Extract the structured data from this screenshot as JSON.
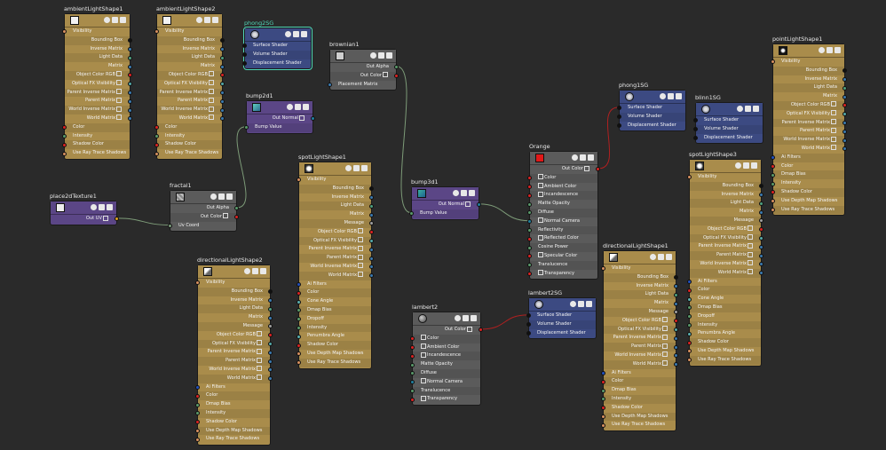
{
  "colors": {
    "background": "#2a2a2a",
    "light_node": "#a98c4b",
    "shading_group": "#3c4a82",
    "bump": "#5b4686",
    "material": "#5b5b5b",
    "wire_red": "#b02020",
    "wire_green": "#7d9b78",
    "selection": "#4fd6b8"
  },
  "nodes": [
    {
      "id": "ambientLightShape1",
      "title": "ambientLightShape1",
      "kind": "gold",
      "thumb": "white",
      "rows": [
        {
          "l": "Visibility",
          "a": "left"
        },
        {
          "l": "Bounding Box",
          "a": "right"
        },
        {
          "l": "Inverse Matrix",
          "a": "right"
        },
        {
          "l": "Light Data",
          "a": "right"
        },
        {
          "l": "Matrix",
          "a": "right"
        },
        {
          "l": "Object Color RGB",
          "a": "right",
          "e": 1
        },
        {
          "l": "Optical FX Visibility",
          "a": "right",
          "e": 1
        },
        {
          "l": "Parent Inverse Matrix",
          "a": "right",
          "e": 1
        },
        {
          "l": "Parent Matrix",
          "a": "right",
          "e": 1
        },
        {
          "l": "World Inverse Matrix",
          "a": "right",
          "e": 1
        },
        {
          "l": "World Matrix",
          "a": "right",
          "e": 1
        },
        {
          "l": "Color",
          "a": "left"
        },
        {
          "l": "Intensity",
          "a": "left"
        },
        {
          "l": "Shadow Color",
          "a": "left"
        },
        {
          "l": "Use Ray Trace Shadows",
          "a": "left"
        }
      ]
    },
    {
      "id": "ambientLightShape2",
      "title": "ambientLightShape2",
      "kind": "gold",
      "thumb": "white",
      "rows": [
        {
          "l": "Visibility",
          "a": "left"
        },
        {
          "l": "Bounding Box",
          "a": "right"
        },
        {
          "l": "Inverse Matrix",
          "a": "right"
        },
        {
          "l": "Light Data",
          "a": "right"
        },
        {
          "l": "Matrix",
          "a": "right"
        },
        {
          "l": "Object Color RGB",
          "a": "right",
          "e": 1
        },
        {
          "l": "Optical FX Visibility",
          "a": "right",
          "e": 1
        },
        {
          "l": "Parent Inverse Matrix",
          "a": "right",
          "e": 1
        },
        {
          "l": "Parent Matrix",
          "a": "right",
          "e": 1
        },
        {
          "l": "World Inverse Matrix",
          "a": "right",
          "e": 1
        },
        {
          "l": "World Matrix",
          "a": "right",
          "e": 1
        },
        {
          "l": "Color",
          "a": "left"
        },
        {
          "l": "Intensity",
          "a": "left"
        },
        {
          "l": "Shadow Color",
          "a": "left"
        },
        {
          "l": "Use Ray Trace Shadows",
          "a": "left"
        }
      ]
    },
    {
      "id": "phong2SG",
      "title": "phong2SG",
      "kind": "blue",
      "thumb": "sg",
      "selected": true,
      "rows": [
        {
          "l": "Surface Shader",
          "a": "left"
        },
        {
          "l": "Volume Shader",
          "a": "left"
        },
        {
          "l": "Displacement Shader",
          "a": "left"
        }
      ]
    },
    {
      "id": "brownian1",
      "title": "brownian1",
      "kind": "grey",
      "thumb": "grey",
      "rows": [
        {
          "l": "Out Alpha",
          "a": "right"
        },
        {
          "l": "Out Color",
          "a": "right",
          "e": 1
        },
        {
          "l": "Placement Matrix",
          "a": "left"
        }
      ]
    },
    {
      "id": "bump2d1",
      "title": "bump2d1",
      "kind": "purple",
      "thumb": "bump",
      "rows": [
        {
          "l": "Out Normal",
          "a": "right",
          "e": 1
        },
        {
          "l": "Bump Value",
          "a": "left"
        }
      ]
    },
    {
      "id": "place2dTexture1",
      "title": "place2dTexture1",
      "kind": "purple",
      "thumb": "place",
      "rows": [
        {
          "l": "Out UV",
          "a": "right",
          "e": 1
        }
      ]
    },
    {
      "id": "fractal1",
      "title": "fractal1",
      "kind": "grey",
      "thumb": "fractal",
      "rows": [
        {
          "l": "Out Alpha",
          "a": "right"
        },
        {
          "l": "Out Color",
          "a": "right",
          "e": 1
        },
        {
          "l": "Uv Coord",
          "a": "left"
        }
      ]
    },
    {
      "id": "spotLightShape1",
      "title": "spotLightShape1",
      "kind": "gold",
      "thumb": "spot",
      "rows": [
        {
          "l": "Visibility",
          "a": "left"
        },
        {
          "l": "Bounding Box",
          "a": "right"
        },
        {
          "l": "Inverse Matrix",
          "a": "right"
        },
        {
          "l": "Light Data",
          "a": "right"
        },
        {
          "l": "Matrix",
          "a": "right"
        },
        {
          "l": "Message",
          "a": "right"
        },
        {
          "l": "Object Color RGB",
          "a": "right",
          "e": 1
        },
        {
          "l": "Optical FX Visibility",
          "a": "right",
          "e": 1
        },
        {
          "l": "Parent Inverse Matrix",
          "a": "right",
          "e": 1
        },
        {
          "l": "Parent Matrix",
          "a": "right",
          "e": 1
        },
        {
          "l": "World Inverse Matrix",
          "a": "right",
          "e": 1
        },
        {
          "l": "World Matrix",
          "a": "right",
          "e": 1
        },
        {
          "l": "Ai Filters",
          "a": "left"
        },
        {
          "l": "Color",
          "a": "left"
        },
        {
          "l": "Cone Angle",
          "a": "left"
        },
        {
          "l": "Dmap Bias",
          "a": "left"
        },
        {
          "l": "Dropoff",
          "a": "left"
        },
        {
          "l": "Intensity",
          "a": "left"
        },
        {
          "l": "Penumbra Angle",
          "a": "left"
        },
        {
          "l": "Shadow Color",
          "a": "left"
        },
        {
          "l": "Use Depth Map Shadows",
          "a": "left"
        },
        {
          "l": "Use Ray Trace Shadows",
          "a": "left"
        }
      ]
    },
    {
      "id": "directionalLightShape2",
      "title": "directionalLightShape2",
      "kind": "gold",
      "thumb": "dir",
      "rows": [
        {
          "l": "Visibility",
          "a": "left"
        },
        {
          "l": "Bounding Box",
          "a": "right"
        },
        {
          "l": "Inverse Matrix",
          "a": "right"
        },
        {
          "l": "Light Data",
          "a": "right"
        },
        {
          "l": "Matrix",
          "a": "right"
        },
        {
          "l": "Message",
          "a": "right"
        },
        {
          "l": "Object Color RGB",
          "a": "right",
          "e": 1
        },
        {
          "l": "Optical FX Visibility",
          "a": "right",
          "e": 1
        },
        {
          "l": "Parent Inverse Matrix",
          "a": "right",
          "e": 1
        },
        {
          "l": "Parent Matrix",
          "a": "right",
          "e": 1
        },
        {
          "l": "World Inverse Matrix",
          "a": "right",
          "e": 1
        },
        {
          "l": "World Matrix",
          "a": "right",
          "e": 1
        },
        {
          "l": "Ai Filters",
          "a": "left"
        },
        {
          "l": "Color",
          "a": "left"
        },
        {
          "l": "Dmap Bias",
          "a": "left"
        },
        {
          "l": "Intensity",
          "a": "left"
        },
        {
          "l": "Shadow Color",
          "a": "left"
        },
        {
          "l": "Use Depth Map Shadows",
          "a": "left"
        },
        {
          "l": "Use Ray Trace Shadows",
          "a": "left"
        }
      ]
    },
    {
      "id": "bump3d1",
      "title": "bump3d1",
      "kind": "purple",
      "thumb": "bump3",
      "rows": [
        {
          "l": "Out Normal",
          "a": "right",
          "e": 1
        },
        {
          "l": "Bump Value",
          "a": "left"
        }
      ]
    },
    {
      "id": "Orange",
      "title": "Orange",
      "kind": "grey",
      "thumb": "red",
      "rows": [
        {
          "l": "Out Color",
          "a": "right",
          "e": 1
        },
        {
          "l": "Color",
          "a": "left",
          "e": 1
        },
        {
          "l": "Ambient Color",
          "a": "left",
          "e": 1
        },
        {
          "l": "Incandescence",
          "a": "left",
          "e": 1
        },
        {
          "l": "Matte Opacity",
          "a": "left"
        },
        {
          "l": "Diffuse",
          "a": "left"
        },
        {
          "l": "Normal Camera",
          "a": "left",
          "e": 1
        },
        {
          "l": "Reflectivity",
          "a": "left"
        },
        {
          "l": "Reflected Color",
          "a": "left",
          "e": 1
        },
        {
          "l": "Cosine Power",
          "a": "left"
        },
        {
          "l": "Specular Color",
          "a": "left",
          "e": 1
        },
        {
          "l": "Translucence",
          "a": "left"
        },
        {
          "l": "Transparency",
          "a": "left",
          "e": 1
        }
      ]
    },
    {
      "id": "lambert2",
      "title": "lambert2",
      "kind": "grey",
      "thumb": "ball",
      "rows": [
        {
          "l": "Out Color",
          "a": "right",
          "e": 1
        },
        {
          "l": "Color",
          "a": "left",
          "e": 1
        },
        {
          "l": "Ambient Color",
          "a": "left",
          "e": 1
        },
        {
          "l": "Incandescence",
          "a": "left",
          "e": 1
        },
        {
          "l": "Matte Opacity",
          "a": "left"
        },
        {
          "l": "Diffuse",
          "a": "left"
        },
        {
          "l": "Normal Camera",
          "a": "left",
          "e": 1
        },
        {
          "l": "Translucence",
          "a": "left"
        },
        {
          "l": "Transparency",
          "a": "left",
          "e": 1
        }
      ]
    },
    {
      "id": "lambert2SG",
      "title": "lambert2SG",
      "kind": "blue",
      "thumb": "sg",
      "rows": [
        {
          "l": "Surface Shader",
          "a": "left"
        },
        {
          "l": "Volume Shader",
          "a": "left"
        },
        {
          "l": "Displacement Shader",
          "a": "left"
        }
      ]
    },
    {
      "id": "phong1SG",
      "title": "phong1SG",
      "kind": "blue",
      "thumb": "sg",
      "rows": [
        {
          "l": "Surface Shader",
          "a": "left"
        },
        {
          "l": "Volume Shader",
          "a": "left"
        },
        {
          "l": "Displacement Shader",
          "a": "left"
        }
      ]
    },
    {
      "id": "blinn1SG",
      "title": "blinn1SG",
      "kind": "blue",
      "thumb": "sg",
      "rows": [
        {
          "l": "Surface Shader",
          "a": "left"
        },
        {
          "l": "Volume Shader",
          "a": "left"
        },
        {
          "l": "Displacement Shader",
          "a": "left"
        }
      ]
    },
    {
      "id": "directionalLightShape1",
      "title": "directionalLightShape1",
      "kind": "gold",
      "thumb": "dir",
      "rows": [
        {
          "l": "Visibility",
          "a": "left"
        },
        {
          "l": "Bounding Box",
          "a": "right"
        },
        {
          "l": "Inverse Matrix",
          "a": "right"
        },
        {
          "l": "Light Data",
          "a": "right"
        },
        {
          "l": "Matrix",
          "a": "right"
        },
        {
          "l": "Message",
          "a": "right"
        },
        {
          "l": "Object Color RGB",
          "a": "right",
          "e": 1
        },
        {
          "l": "Optical FX Visibility",
          "a": "right",
          "e": 1
        },
        {
          "l": "Parent Inverse Matrix",
          "a": "right",
          "e": 1
        },
        {
          "l": "Parent Matrix",
          "a": "right",
          "e": 1
        },
        {
          "l": "World Inverse Matrix",
          "a": "right",
          "e": 1
        },
        {
          "l": "World Matrix",
          "a": "right",
          "e": 1
        },
        {
          "l": "Ai Filters",
          "a": "left"
        },
        {
          "l": "Color",
          "a": "left"
        },
        {
          "l": "Dmap Bias",
          "a": "left"
        },
        {
          "l": "Intensity",
          "a": "left"
        },
        {
          "l": "Shadow Color",
          "a": "left"
        },
        {
          "l": "Use Depth Map Shadows",
          "a": "left"
        },
        {
          "l": "Use Ray Trace Shadows",
          "a": "left"
        }
      ]
    },
    {
      "id": "spotLightShape3",
      "title": "spotLightShape3",
      "kind": "gold",
      "thumb": "spot",
      "rows": [
        {
          "l": "Visibility",
          "a": "left"
        },
        {
          "l": "Bounding Box",
          "a": "right"
        },
        {
          "l": "Inverse Matrix",
          "a": "right"
        },
        {
          "l": "Light Data",
          "a": "right"
        },
        {
          "l": "Matrix",
          "a": "right"
        },
        {
          "l": "Message",
          "a": "right"
        },
        {
          "l": "Object Color RGB",
          "a": "right",
          "e": 1
        },
        {
          "l": "Optical FX Visibility",
          "a": "right",
          "e": 1
        },
        {
          "l": "Parent Inverse Matrix",
          "a": "right",
          "e": 1
        },
        {
          "l": "Parent Matrix",
          "a": "right",
          "e": 1
        },
        {
          "l": "World Inverse Matrix",
          "a": "right",
          "e": 1
        },
        {
          "l": "World Matrix",
          "a": "right",
          "e": 1
        },
        {
          "l": "Ai Filters",
          "a": "left"
        },
        {
          "l": "Color",
          "a": "left"
        },
        {
          "l": "Cone Angle",
          "a": "left"
        },
        {
          "l": "Dmap Bias",
          "a": "left"
        },
        {
          "l": "Dropoff",
          "a": "left"
        },
        {
          "l": "Intensity",
          "a": "left"
        },
        {
          "l": "Penumbra Angle",
          "a": "left"
        },
        {
          "l": "Shadow Color",
          "a": "left"
        },
        {
          "l": "Use Depth Map Shadows",
          "a": "left"
        },
        {
          "l": "Use Ray Trace Shadows",
          "a": "left"
        }
      ]
    },
    {
      "id": "pointLightShape1",
      "title": "pointLightShape1",
      "kind": "gold",
      "thumb": "point",
      "rows": [
        {
          "l": "Visibility",
          "a": "left"
        },
        {
          "l": "Bounding Box",
          "a": "right"
        },
        {
          "l": "Inverse Matrix",
          "a": "right"
        },
        {
          "l": "Light Data",
          "a": "right"
        },
        {
          "l": "Matrix",
          "a": "right"
        },
        {
          "l": "Object Color RGB",
          "a": "right",
          "e": 1
        },
        {
          "l": "Optical FX Visibility",
          "a": "right",
          "e": 1
        },
        {
          "l": "Parent Inverse Matrix",
          "a": "right",
          "e": 1
        },
        {
          "l": "Parent Matrix",
          "a": "right",
          "e": 1
        },
        {
          "l": "World Inverse Matrix",
          "a": "right",
          "e": 1
        },
        {
          "l": "World Matrix",
          "a": "right",
          "e": 1
        },
        {
          "l": "Ai Filters",
          "a": "left"
        },
        {
          "l": "Color",
          "a": "left"
        },
        {
          "l": "Dmap Bias",
          "a": "left"
        },
        {
          "l": "Intensity",
          "a": "left"
        },
        {
          "l": "Shadow Color",
          "a": "left"
        },
        {
          "l": "Use Depth Map Shadows",
          "a": "left"
        },
        {
          "l": "Use Ray Trace Shadows",
          "a": "left"
        }
      ]
    }
  ]
}
